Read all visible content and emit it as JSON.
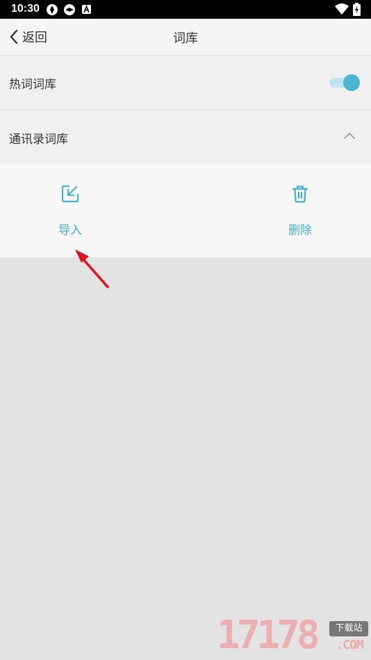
{
  "status_bar": {
    "time": "10:30"
  },
  "nav": {
    "back_label": "返回",
    "title": "词库"
  },
  "settings": {
    "hot_words": {
      "label": "热词词库",
      "enabled": true
    },
    "contacts": {
      "label": "通讯录词库",
      "expanded": true
    }
  },
  "actions": {
    "import_label": "导入",
    "delete_label": "删除"
  },
  "watermark": {
    "digits": "17178",
    "badge": "下载站",
    "suffix": ".COM"
  },
  "colors": {
    "accent": "#42b1cf",
    "arrow": "#e0141e"
  }
}
